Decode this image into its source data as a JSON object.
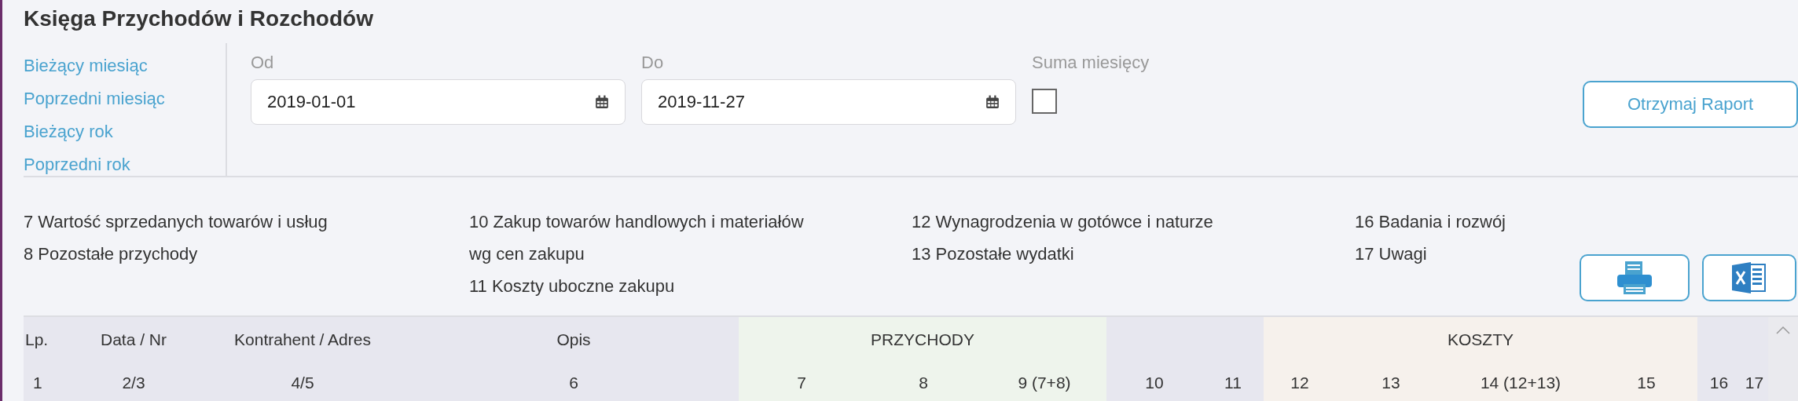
{
  "title": "Księga Przychodów i Rozchodów",
  "quick_links": [
    "Bieżący miesiąc",
    "Poprzedni miesiąc",
    "Bieżący rok",
    "Poprzedni rok"
  ],
  "date_from": {
    "label": "Od",
    "value": "2019-01-01"
  },
  "date_to": {
    "label": "Do",
    "value": "2019-11-27"
  },
  "sum_months": {
    "label": "Suma miesięcy",
    "checked": false
  },
  "report_button": "Otrzymaj Raport",
  "legend": [
    [
      "7 Wartość sprzedanych towarów i usług",
      "8 Pozostałe przychody"
    ],
    [
      "10 Zakup towarów handlowych i materiałów wg cen zakupu",
      "11 Koszty uboczne zakupu"
    ],
    [
      "12 Wynagrodzenia w gotówce i naturze",
      "13 Pozostałe wydatki"
    ],
    [
      "16 Badania i rozwój",
      "17 Uwagi"
    ]
  ],
  "export_buttons": [
    {
      "kind": "pdf"
    },
    {
      "kind": "excel"
    }
  ],
  "table": {
    "column_groups": [
      {
        "color": "#e7e7ef",
        "columns": [
          {
            "header": "Lp.",
            "number": "1"
          },
          {
            "header": "Data / Nr",
            "number": "2/3"
          },
          {
            "header": "Kontrahent / Adres",
            "number": "4/5"
          },
          {
            "header": "Opis",
            "number": "6"
          }
        ]
      },
      {
        "label": "PRZYCHODY",
        "color": "#eef4ec",
        "columns": [
          {
            "number": "7"
          },
          {
            "number": "8"
          },
          {
            "number": "9 (7+8)"
          }
        ]
      },
      {
        "color": "#e7e7ef",
        "columns": [
          {
            "number": "10"
          },
          {
            "number": "11"
          }
        ]
      },
      {
        "label": "KOSZTY",
        "color": "#f6f1ec",
        "columns": [
          {
            "number": "12"
          },
          {
            "number": "13"
          },
          {
            "number": "14 (12+13)"
          },
          {
            "number": "15"
          }
        ]
      },
      {
        "color": "#e7e7ef",
        "columns": [
          {
            "number": "16"
          },
          {
            "number": "17"
          }
        ]
      }
    ]
  }
}
